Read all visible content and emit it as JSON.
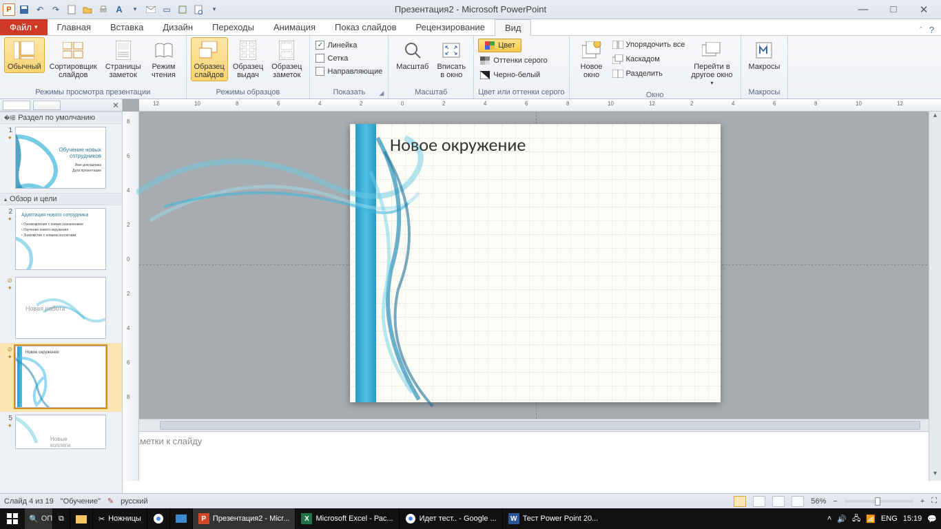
{
  "app": {
    "title": "Презентация2  -  Microsoft PowerPoint",
    "icon_letter": "P"
  },
  "tabs": {
    "file": "Файл",
    "list": [
      "Главная",
      "Вставка",
      "Дизайн",
      "Переходы",
      "Анимация",
      "Показ слайдов",
      "Рецензирование",
      "Вид"
    ],
    "active": "Вид"
  },
  "ribbon": {
    "group_views": {
      "label": "Режимы просмотра презентации",
      "normal": "Обычный",
      "sorter": "Сортировщик\nслайдов",
      "notes_page": "Страницы\nзаметок",
      "reading": "Режим\nчтения"
    },
    "group_masters": {
      "label": "Режимы образцов",
      "slide_master": "Образец\nслайдов",
      "handout_master": "Образец\nвыдач",
      "notes_master": "Образец\nзаметок"
    },
    "group_show": {
      "label": "Показать",
      "ruler": "Линейка",
      "grid": "Сетка",
      "guides": "Направляющие"
    },
    "group_zoom": {
      "label": "Масштаб",
      "zoom": "Масштаб",
      "fit": "Вписать\nв окно"
    },
    "group_color": {
      "label": "Цвет или оттенки серого",
      "color": "Цвет",
      "gray": "Оттенки серого",
      "bw": "Черно-белый"
    },
    "group_window": {
      "label": "Окно",
      "new": "Новое\nокно",
      "arrange": "Упорядочить все",
      "cascade": "Каскадом",
      "split": "Разделить",
      "switch": "Перейти в\nдругое окно"
    },
    "group_macros": {
      "label": "Макросы",
      "macros": "Макросы"
    }
  },
  "sections": {
    "default": "Раздел по умолчанию",
    "review": "Обзор и цели"
  },
  "thumbs": {
    "s1": {
      "num": "1",
      "title": "Обучение новых\nсотрудников",
      "sub1": "Имя докладчика",
      "sub2": "Дата презентации"
    },
    "s2": {
      "num": "2",
      "title": "Адаптация нового сотрудника",
      "b1": "Ознакомление с новым назначением",
      "b2": "Изучение нового окружения",
      "b3": "Знакомство с новыми коллегами"
    },
    "s3": {
      "title": "Новая работа"
    },
    "s4": {
      "title": "Новое окружение"
    },
    "s5": {
      "num": "5",
      "title": "Новые\nколлеги"
    }
  },
  "slide": {
    "title": "Новое окружение"
  },
  "notes": {
    "placeholder": "Заметки к слайду"
  },
  "status": {
    "slide_info": "Слайд 4 из 19",
    "theme": "\"Обучение\"",
    "lang": "русский",
    "zoom": "56%"
  },
  "taskbar": {
    "search": "ОП",
    "items": [
      "Ножницы",
      "Презентация2 - Micr...",
      "Microsoft Excel - Рас...",
      "Идет тест.. - Google ...",
      "Тест  Power Point 20..."
    ],
    "lang": "ENG",
    "time": "15:19"
  },
  "ruler_h": [
    "12",
    "10",
    "8",
    "6",
    "4",
    "2",
    "0",
    "2",
    "4",
    "6",
    "8",
    "10",
    "12",
    "2",
    "4",
    "6",
    "8",
    "10",
    "12"
  ],
  "ruler_v": [
    "8",
    "6",
    "4",
    "2",
    "0",
    "2",
    "4",
    "6",
    "8"
  ]
}
